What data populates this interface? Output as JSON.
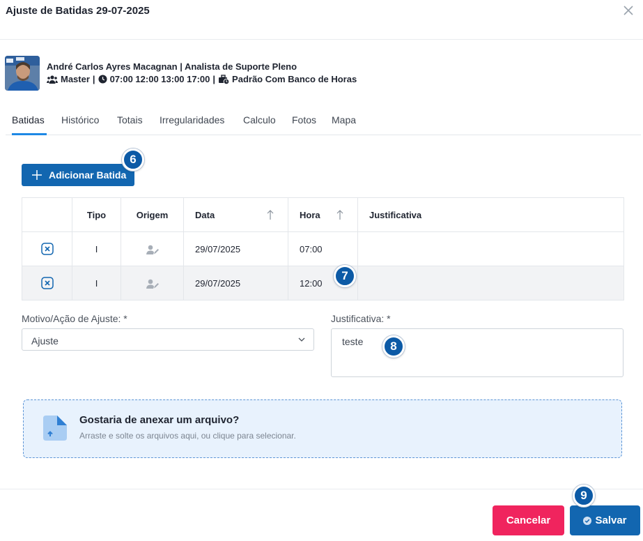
{
  "modal": {
    "title": "Ajuste de Batidas 29-07-2025"
  },
  "employee": {
    "name_line": "André Carlos Ayres Macagnan | Analista de Suporte Pleno",
    "group": "Master",
    "schedule": "07:00 12:00 13:00 17:00",
    "bank": "Padrão Com Banco de Horas",
    "separator": "|"
  },
  "tabs": [
    "Batidas",
    "Histórico",
    "Totais",
    "Irregularidades",
    "Calculo",
    "Fotos",
    "Mapa"
  ],
  "active_tab": "Batidas",
  "add_button": {
    "label": "Adicionar Batida"
  },
  "table": {
    "headers": {
      "tipo": "Tipo",
      "origem": "Origem",
      "data": "Data",
      "hora": "Hora",
      "justificativa": "Justificativa"
    },
    "rows": [
      {
        "tipo": "I",
        "origem_icon": "user-edit-icon",
        "data": "29/07/2025",
        "hora": "07:00",
        "justificativa": ""
      },
      {
        "tipo": "I",
        "origem_icon": "user-edit-icon",
        "data": "29/07/2025",
        "hora": "12:00",
        "justificativa": ""
      }
    ]
  },
  "form": {
    "motivo_label": "Motivo/Ação de Ajuste: *",
    "motivo_value": "Ajuste",
    "justificativa_label": "Justificativa: *",
    "justificativa_value": "teste"
  },
  "dropzone": {
    "title": "Gostaria de anexar um arquivo?",
    "subtitle": "Arraste e solte os arquivos aqui, ou clique para selecionar."
  },
  "footer": {
    "cancel_label": "Cancelar",
    "save_label": "Salvar"
  },
  "step_badges": [
    "6",
    "7",
    "8",
    "9"
  ],
  "colors": {
    "primary": "#1266b0",
    "danger": "#f0245e",
    "tab_accent": "#1e88e5",
    "dropzone_bg": "#e8f2fd"
  }
}
